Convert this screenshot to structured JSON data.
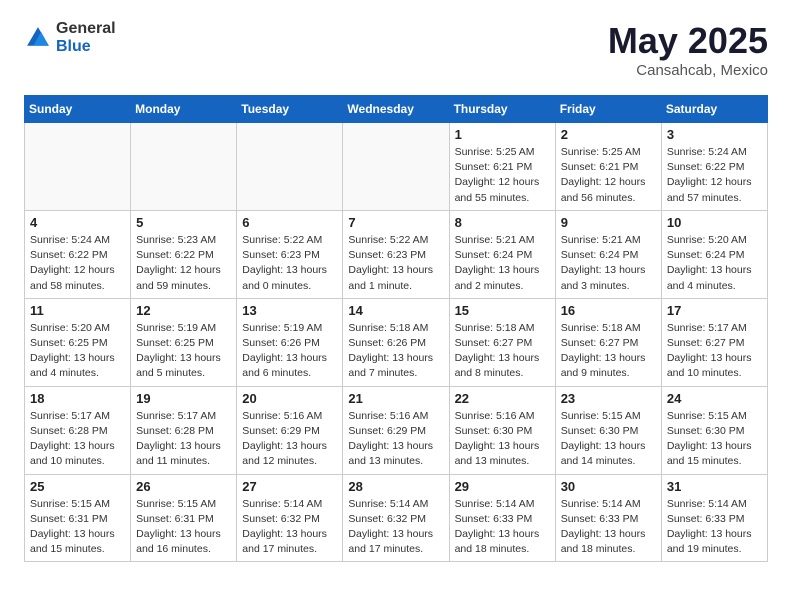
{
  "header": {
    "logo_general": "General",
    "logo_blue": "Blue",
    "month": "May 2025",
    "location": "Cansahcab, Mexico"
  },
  "weekdays": [
    "Sunday",
    "Monday",
    "Tuesday",
    "Wednesday",
    "Thursday",
    "Friday",
    "Saturday"
  ],
  "weeks": [
    [
      {
        "day": "",
        "empty": true
      },
      {
        "day": "",
        "empty": true
      },
      {
        "day": "",
        "empty": true
      },
      {
        "day": "",
        "empty": true
      },
      {
        "day": "1",
        "sunrise": "5:25 AM",
        "sunset": "6:21 PM",
        "daylight": "12 hours and 55 minutes."
      },
      {
        "day": "2",
        "sunrise": "5:25 AM",
        "sunset": "6:21 PM",
        "daylight": "12 hours and 56 minutes."
      },
      {
        "day": "3",
        "sunrise": "5:24 AM",
        "sunset": "6:22 PM",
        "daylight": "12 hours and 57 minutes."
      }
    ],
    [
      {
        "day": "4",
        "sunrise": "5:24 AM",
        "sunset": "6:22 PM",
        "daylight": "12 hours and 58 minutes."
      },
      {
        "day": "5",
        "sunrise": "5:23 AM",
        "sunset": "6:22 PM",
        "daylight": "12 hours and 59 minutes."
      },
      {
        "day": "6",
        "sunrise": "5:22 AM",
        "sunset": "6:23 PM",
        "daylight": "13 hours and 0 minutes."
      },
      {
        "day": "7",
        "sunrise": "5:22 AM",
        "sunset": "6:23 PM",
        "daylight": "13 hours and 1 minute."
      },
      {
        "day": "8",
        "sunrise": "5:21 AM",
        "sunset": "6:24 PM",
        "daylight": "13 hours and 2 minutes."
      },
      {
        "day": "9",
        "sunrise": "5:21 AM",
        "sunset": "6:24 PM",
        "daylight": "13 hours and 3 minutes."
      },
      {
        "day": "10",
        "sunrise": "5:20 AM",
        "sunset": "6:24 PM",
        "daylight": "13 hours and 4 minutes."
      }
    ],
    [
      {
        "day": "11",
        "sunrise": "5:20 AM",
        "sunset": "6:25 PM",
        "daylight": "13 hours and 4 minutes."
      },
      {
        "day": "12",
        "sunrise": "5:19 AM",
        "sunset": "6:25 PM",
        "daylight": "13 hours and 5 minutes."
      },
      {
        "day": "13",
        "sunrise": "5:19 AM",
        "sunset": "6:26 PM",
        "daylight": "13 hours and 6 minutes."
      },
      {
        "day": "14",
        "sunrise": "5:18 AM",
        "sunset": "6:26 PM",
        "daylight": "13 hours and 7 minutes."
      },
      {
        "day": "15",
        "sunrise": "5:18 AM",
        "sunset": "6:27 PM",
        "daylight": "13 hours and 8 minutes."
      },
      {
        "day": "16",
        "sunrise": "5:18 AM",
        "sunset": "6:27 PM",
        "daylight": "13 hours and 9 minutes."
      },
      {
        "day": "17",
        "sunrise": "5:17 AM",
        "sunset": "6:27 PM",
        "daylight": "13 hours and 10 minutes."
      }
    ],
    [
      {
        "day": "18",
        "sunrise": "5:17 AM",
        "sunset": "6:28 PM",
        "daylight": "13 hours and 10 minutes."
      },
      {
        "day": "19",
        "sunrise": "5:17 AM",
        "sunset": "6:28 PM",
        "daylight": "13 hours and 11 minutes."
      },
      {
        "day": "20",
        "sunrise": "5:16 AM",
        "sunset": "6:29 PM",
        "daylight": "13 hours and 12 minutes."
      },
      {
        "day": "21",
        "sunrise": "5:16 AM",
        "sunset": "6:29 PM",
        "daylight": "13 hours and 13 minutes."
      },
      {
        "day": "22",
        "sunrise": "5:16 AM",
        "sunset": "6:30 PM",
        "daylight": "13 hours and 13 minutes."
      },
      {
        "day": "23",
        "sunrise": "5:15 AM",
        "sunset": "6:30 PM",
        "daylight": "13 hours and 14 minutes."
      },
      {
        "day": "24",
        "sunrise": "5:15 AM",
        "sunset": "6:30 PM",
        "daylight": "13 hours and 15 minutes."
      }
    ],
    [
      {
        "day": "25",
        "sunrise": "5:15 AM",
        "sunset": "6:31 PM",
        "daylight": "13 hours and 15 minutes."
      },
      {
        "day": "26",
        "sunrise": "5:15 AM",
        "sunset": "6:31 PM",
        "daylight": "13 hours and 16 minutes."
      },
      {
        "day": "27",
        "sunrise": "5:14 AM",
        "sunset": "6:32 PM",
        "daylight": "13 hours and 17 minutes."
      },
      {
        "day": "28",
        "sunrise": "5:14 AM",
        "sunset": "6:32 PM",
        "daylight": "13 hours and 17 minutes."
      },
      {
        "day": "29",
        "sunrise": "5:14 AM",
        "sunset": "6:33 PM",
        "daylight": "13 hours and 18 minutes."
      },
      {
        "day": "30",
        "sunrise": "5:14 AM",
        "sunset": "6:33 PM",
        "daylight": "13 hours and 18 minutes."
      },
      {
        "day": "31",
        "sunrise": "5:14 AM",
        "sunset": "6:33 PM",
        "daylight": "13 hours and 19 minutes."
      }
    ]
  ]
}
